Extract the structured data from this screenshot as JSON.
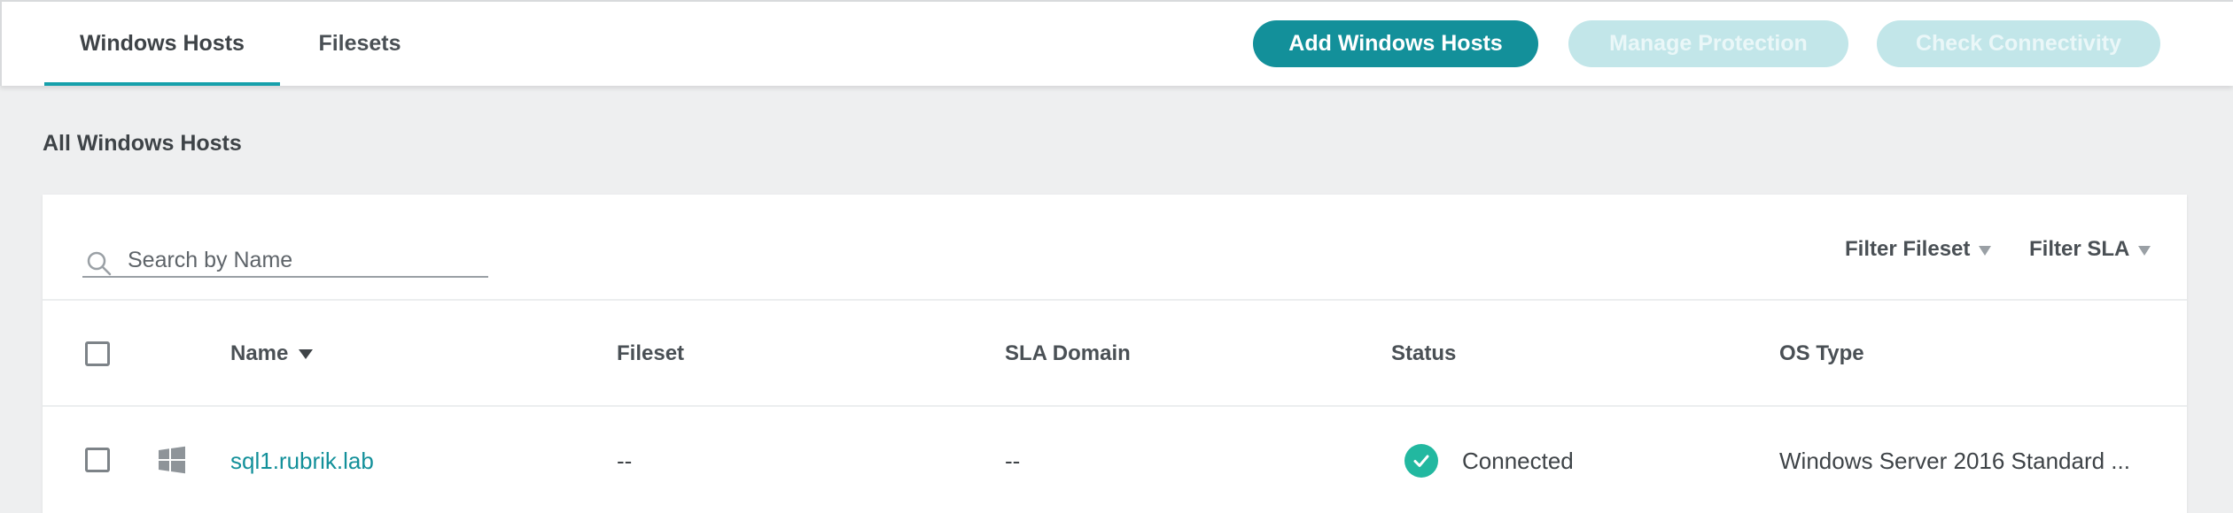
{
  "tabs": [
    {
      "label": "Windows Hosts",
      "active": true
    },
    {
      "label": "Filesets",
      "active": false
    }
  ],
  "actions": {
    "add_label": "Add Windows Hosts",
    "manage_label": "Manage Protection",
    "check_label": "Check Connectivity"
  },
  "section_title": "All Windows Hosts",
  "search": {
    "placeholder": "Search by Name",
    "value": ""
  },
  "filters": {
    "fileset": "Filter Fileset",
    "sla": "Filter SLA"
  },
  "table": {
    "columns": {
      "name": "Name",
      "fileset": "Fileset",
      "sla_domain": "SLA Domain",
      "status": "Status",
      "os_type": "OS Type"
    },
    "sort": {
      "column": "name",
      "direction": "descending"
    },
    "rows": [
      {
        "icon": "windows-icon",
        "name": "sql1.rubrik.lab",
        "fileset": "--",
        "sla_domain": "--",
        "status": "Connected",
        "status_icon": "check-circle-icon",
        "os_type": "Windows Server 2016 Standard ..."
      }
    ]
  },
  "colors": {
    "accent": "#13909a",
    "accent_disabled": "#c2e6e9",
    "status_ok": "#22b8a0",
    "background": "#eeeff0"
  }
}
